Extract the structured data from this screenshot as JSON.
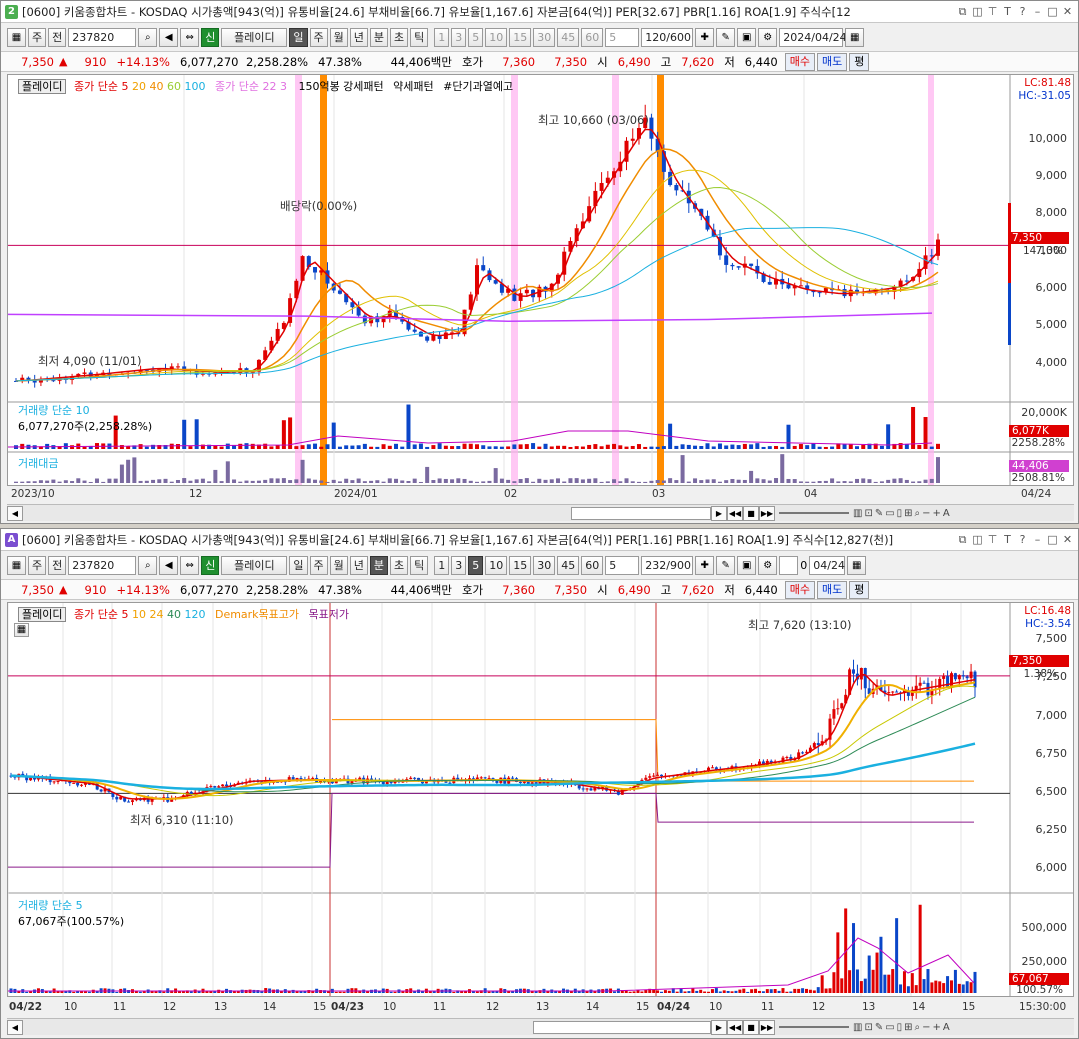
{
  "top": {
    "window_num": "2",
    "title": "[0600] 키움종합차트 - KOSDAQ 시가총액[943(억)] 유통비율[24.6] 부채비율[66.7] 유보율[1,167.6] 자본금[64(억)] PER[32.67] PBR[1.16] ROA[1.9] 주식수[12",
    "toolbar": {
      "mode": "주",
      "prev": "전",
      "code": "237820",
      "sin": "신",
      "name": "플레이디",
      "periods": [
        "일",
        "주",
        "월",
        "년",
        "분",
        "초",
        "틱"
      ],
      "active_period": "일",
      "nums": [
        "1",
        "3",
        "5",
        "10",
        "15",
        "30",
        "45",
        "60"
      ],
      "count": "5",
      "range": "120/600",
      "date": "2024/04/24"
    },
    "price": {
      "close": "7,350",
      "change": "910",
      "pct": "+14.13%",
      "volume": "6,077,270",
      "vol_pct": "2,258.28%",
      "turnover": "47.38%",
      "amount": "44,406백만",
      "hoga_label": "호가",
      "bid": "7,360",
      "ask": "7,350",
      "open_label": "시",
      "open": "6,490",
      "high_label": "고",
      "high": "7,620",
      "low_label": "저",
      "low": "6,440",
      "buy": "매수",
      "sell": "매도",
      "flat": "평"
    },
    "legend": {
      "name": "플레이디",
      "ma_label": "종가 단순 5",
      "ma2": "20",
      "ma3": "40",
      "ma4": "60",
      "ma5": "100",
      "ma_label2": "종가 단순 22",
      "ma6": "3",
      "note1": "150억봉 강세패턴",
      "note2": "약세패턴",
      "note3": "#단기과열예고"
    },
    "annotations": {
      "dividend": "배당락(0.00%)",
      "high": "최고 10,660 (03/06)",
      "low": "최저 4,090 (11/01)"
    },
    "y_ticks": [
      "10,000",
      "9,000",
      "8,000",
      "7,000",
      "6,000",
      "5,000",
      "4,000"
    ],
    "lc": "LC:81.48",
    "hc": "HC:-31.05",
    "price_tag": "7,350",
    "price_pct": "14.13%",
    "vol_legend": "거래량 단순 10",
    "vol_value": "6,077,270주(2,258.28%)",
    "vol_tick": "20,000K",
    "vol_tag": "6,077K",
    "vol_tag_pct": "2258.28%",
    "amt_legend": "거래대금",
    "amt_tag": "44,406",
    "amt_tag_pct": "2508.81%",
    "x_labels": [
      "2023/10",
      "12",
      "2024/01",
      "02",
      "03",
      "04"
    ],
    "x_right": "04/24"
  },
  "bottom": {
    "window_num": "A",
    "title": "[0600] 키움종합차트 - KOSDAQ 시가총액[943(억)] 유통비율[24.6] 부채비율[66.7] 유보율[1,167.6] 자본금[64(억)] PER[1.16] PBR[1.16] ROA[1.9] 주식수[12,827(천)]",
    "toolbar": {
      "mode": "주",
      "prev": "전",
      "code": "237820",
      "sin": "신",
      "name": "플레이디",
      "periods": [
        "일",
        "주",
        "월",
        "년",
        "분",
        "초",
        "틱"
      ],
      "active_period": "분",
      "nums": [
        "1",
        "3",
        "5",
        "10",
        "15",
        "30",
        "45",
        "60"
      ],
      "active_num": "5",
      "count": "5",
      "range": "232/900",
      "extra": "0",
      "date": "04/24"
    },
    "price": {
      "close": "7,350",
      "change": "910",
      "pct": "+14.13%",
      "volume": "6,077,270",
      "vol_pct": "2,258.28%",
      "turnover": "47.38%",
      "amount": "44,406백만",
      "hoga_label": "호가",
      "bid": "7,360",
      "ask": "7,350",
      "open_label": "시",
      "open": "6,490",
      "high_label": "고",
      "high": "7,620",
      "low_label": "저",
      "low": "6,440",
      "buy": "매수",
      "sell": "매도",
      "flat": "평"
    },
    "legend": {
      "name": "플레이디",
      "ma_label": "종가 단순 5",
      "ma2": "10",
      "ma3": "24",
      "ma4": "40",
      "ma5": "120",
      "demark": "Demark목표고가",
      "demark2": "목표저가"
    },
    "annotations": {
      "high": "최고 7,620 (13:10)",
      "low": "최저 6,310 (11:10)"
    },
    "y_ticks": [
      "7,500",
      "7,250",
      "7,000",
      "6,750",
      "6,500",
      "6,250",
      "6,000"
    ],
    "lc": "LC:16.48",
    "hc": "HC:-3.54",
    "price_tag": "7,350",
    "price_pct": "1.38%",
    "vol_legend": "거래량 단순 5",
    "vol_value": "67,067주(100.57%)",
    "vol_ticks": [
      "500,000",
      "250,000"
    ],
    "vol_tag": "67,067",
    "vol_tag_pct": "100.57%",
    "x_labels": [
      "04/22",
      "10",
      "11",
      "12",
      "13",
      "14",
      "15",
      "04/23",
      "10",
      "11",
      "12",
      "13",
      "14",
      "15",
      "04/24",
      "10",
      "11",
      "12",
      "13",
      "14",
      "15"
    ],
    "x_right": "15:30:00"
  },
  "colors": {
    "up": "#e00000",
    "down": "#0a46c8",
    "ma5": "#e00000",
    "ma20": "#f08c00",
    "ma60": "#9acd32",
    "ma100": "#1ab0e0",
    "ma_long": "#c040ff",
    "band": "#ffb0f0",
    "orange": "#ff8c00"
  }
}
